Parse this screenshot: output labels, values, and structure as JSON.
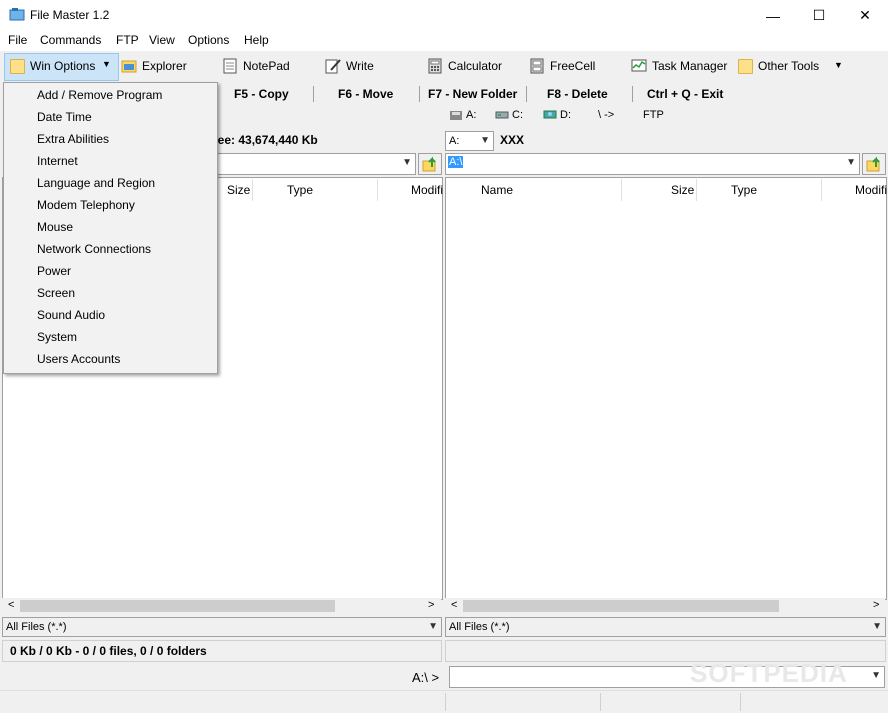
{
  "window": {
    "title": "File Master 1.2",
    "min": "—",
    "max": "☐",
    "close": "✕"
  },
  "menu": [
    "File",
    "Commands",
    "FTP",
    "View",
    "Options",
    "Help"
  ],
  "toolbar": {
    "win_options": "Win Options",
    "explorer": "Explorer",
    "notepad": "NotePad",
    "write": "Write",
    "calculator": "Calculator",
    "freecell": "FreeCell",
    "task_manager": "Task Manager",
    "other_tools": "Other Tools"
  },
  "fkeys": [
    "F5 - Copy",
    "F6 - Move",
    "F7 - New Folder",
    "F8 - Delete",
    "Ctrl + Q - Exit"
  ],
  "dropdown": [
    "Add / Remove Program",
    "Date  Time",
    "Extra Abilities",
    "Internet",
    "Language and Region",
    "Modem  Telephony",
    "Mouse",
    "Network Connections",
    "Power",
    "Screen",
    "Sound  Audio",
    "System",
    "Users Accounts"
  ],
  "left": {
    "free": "ree: 43,674,440 Kb",
    "cols": {
      "size": "Size",
      "type": "Type",
      "modified": "Modifi"
    },
    "filter": "All Files (*.*)",
    "status": "0 Kb / 0 Kb - 0 / 0 files, 0 / 0 folders"
  },
  "right": {
    "drives": {
      "a": "A:",
      "c": "C:",
      "d": "D:",
      "net": "\\ ->",
      "ftp": "FTP"
    },
    "drive_combo": "A:",
    "volume": "XXX",
    "path": "A:\\",
    "cols": {
      "name": "Name",
      "size": "Size",
      "type": "Type",
      "modified": "Modifi"
    },
    "filter": "All Files (*.*)"
  },
  "cmd": {
    "prompt": "A:\\ >"
  },
  "watermark": "SOFTPEDIA"
}
